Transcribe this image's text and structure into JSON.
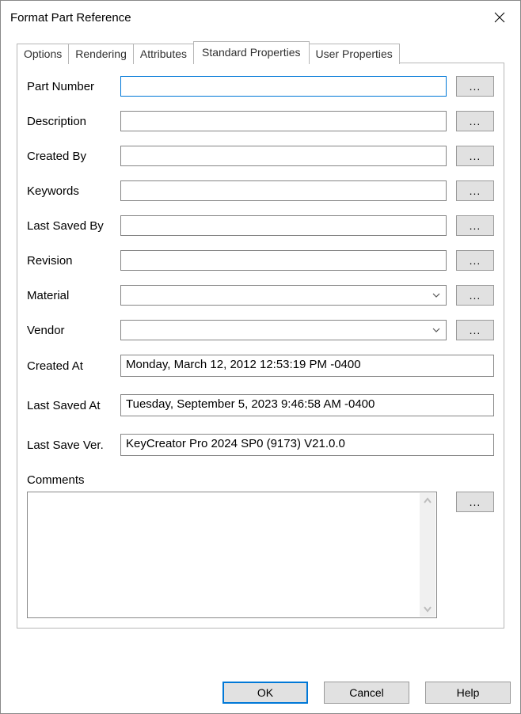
{
  "window": {
    "title": "Format Part Reference"
  },
  "tabs": {
    "options": "Options",
    "rendering": "Rendering",
    "attributes": "Attributes",
    "standard": "Standard Properties",
    "user": "User Properties"
  },
  "labels": {
    "part_number": "Part Number",
    "description": "Description",
    "created_by": "Created By",
    "keywords": "Keywords",
    "last_saved_by": "Last Saved By",
    "revision": "Revision",
    "material": "Material",
    "vendor": "Vendor",
    "created_at": "Created At",
    "last_saved_at": "Last Saved At",
    "last_save_ver": "Last Save Ver.",
    "comments": "Comments"
  },
  "values": {
    "part_number": "",
    "description": "",
    "created_by": "",
    "keywords": "",
    "last_saved_by": "",
    "revision": "",
    "material": "",
    "vendor": "",
    "created_at": "Monday, March 12, 2012 12:53:19 PM -0400",
    "last_saved_at": "Tuesday, September 5, 2023 9:46:58 AM -0400",
    "last_save_ver": "KeyCreator Pro 2024 SP0 (9173) V21.0.0",
    "comments": ""
  },
  "buttons": {
    "browse": "...",
    "ok": "OK",
    "cancel": "Cancel",
    "help": "Help"
  }
}
